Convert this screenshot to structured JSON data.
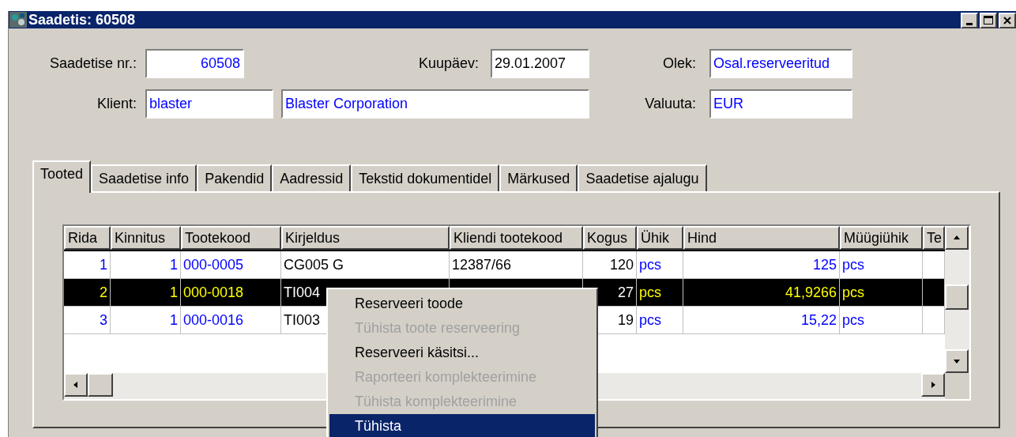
{
  "window": {
    "title": "Saadetis: 60508"
  },
  "form": {
    "shipment_no": {
      "label": "Saadetise nr.:",
      "value": "60508"
    },
    "date": {
      "label": "Kuupäev:",
      "value": "29.01.2007"
    },
    "status": {
      "label": "Olek:",
      "value": "Osal.reserveeritud"
    },
    "client": {
      "label": "Klient:",
      "code": "blaster",
      "name": "Blaster Corporation"
    },
    "currency": {
      "label": "Valuuta:",
      "value": "EUR"
    }
  },
  "tabs": [
    {
      "label": "Tooted",
      "selected": true
    },
    {
      "label": "Saadetise info",
      "selected": false
    },
    {
      "label": "Pakendid",
      "selected": false
    },
    {
      "label": "Aadressid",
      "selected": false
    },
    {
      "label": "Tekstid dokumentidel",
      "selected": false
    },
    {
      "label": "Märkused",
      "selected": false
    },
    {
      "label": "Saadetise ajalugu",
      "selected": false
    }
  ],
  "table": {
    "columns": [
      "Rida",
      "Kinnitus",
      "Tootekood",
      "Kirjeldus",
      "Kliendi tootekood",
      "Kogus",
      "Ühik",
      "Hind",
      "Müügiühik",
      "Te"
    ],
    "rows": [
      {
        "selected": false,
        "cells": [
          "1",
          "1",
          "000-0005",
          "CG005 G",
          "12387/66",
          "120",
          "pcs",
          "125",
          "pcs"
        ]
      },
      {
        "selected": true,
        "cells": [
          "2",
          "1",
          "000-0018",
          "TI004",
          null,
          "27",
          "pcs",
          "41,9266",
          "pcs"
        ]
      },
      {
        "selected": false,
        "cells": [
          "3",
          "1",
          "000-0016",
          "TI003",
          null,
          "19",
          "pcs",
          "15,22",
          "pcs"
        ]
      }
    ]
  },
  "context_menu": {
    "items": [
      {
        "label": "Reserveeri toode",
        "disabled": false,
        "selected": false
      },
      {
        "label": "Tühista toote reserveering",
        "disabled": true,
        "selected": false
      },
      {
        "label": "Reserveeri käsitsi...",
        "disabled": false,
        "selected": false
      },
      {
        "label": "Raporteeri komplekteerimine",
        "disabled": true,
        "selected": false
      },
      {
        "label": "Tühista komplekteerimine",
        "disabled": true,
        "selected": false
      },
      {
        "label": "Tühista",
        "disabled": false,
        "selected": true
      }
    ]
  }
}
